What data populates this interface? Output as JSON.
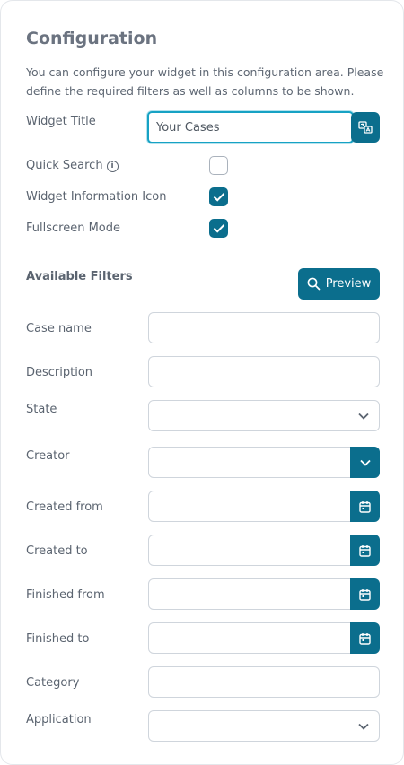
{
  "config": {
    "title": "Configuration",
    "description": "You can configure your widget in this configuration area. Please define the required filters as well as columns to be shown."
  },
  "widget_title": {
    "label": "Widget Title",
    "value": "Your Cases",
    "translate_icon": "translate-icon"
  },
  "options": {
    "quick_search": {
      "label": "Quick Search",
      "checked": false,
      "info_icon": "info-icon"
    },
    "info_icon": {
      "label": "Widget Information Icon",
      "checked": true
    },
    "fullscreen": {
      "label": "Fullscreen Mode",
      "checked": true
    }
  },
  "filters": {
    "section_title": "Available Filters",
    "preview_label": "Preview",
    "case_name": {
      "label": "Case name"
    },
    "description": {
      "label": "Description"
    },
    "state": {
      "label": "State"
    },
    "creator": {
      "label": "Creator"
    },
    "created_from": {
      "label": "Created from"
    },
    "created_to": {
      "label": "Created to"
    },
    "finished_from": {
      "label": "Finished from"
    },
    "finished_to": {
      "label": "Finished to"
    },
    "category": {
      "label": "Category"
    },
    "application": {
      "label": "Application"
    }
  },
  "colors": {
    "accent": "#0b6e8d",
    "focus": "#17a2c4",
    "text": "#5b6470"
  }
}
